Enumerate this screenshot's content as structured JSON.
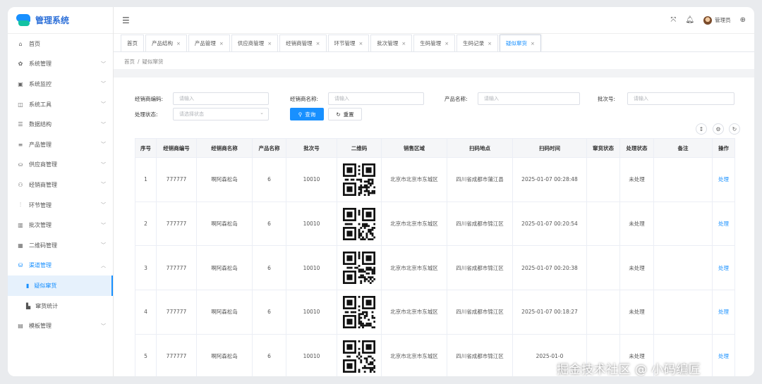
{
  "app": {
    "title": "管理系统"
  },
  "sidebar": {
    "items": [
      {
        "label": "首页",
        "icon": "home-icon",
        "glyph": "⌂",
        "chevron": false
      },
      {
        "label": "系统管理",
        "icon": "gear-icon",
        "glyph": "✿",
        "chevron": true
      },
      {
        "label": "系统监控",
        "icon": "monitor-icon",
        "glyph": "▣",
        "chevron": true
      },
      {
        "label": "系统工具",
        "icon": "toolbox-icon",
        "glyph": "◫",
        "chevron": true
      },
      {
        "label": "数据结构",
        "icon": "structure-icon",
        "glyph": "☰",
        "chevron": true
      },
      {
        "label": "产品管理",
        "icon": "list-icon",
        "glyph": "≡",
        "chevron": true
      },
      {
        "label": "供应商管理",
        "icon": "supplier-icon",
        "glyph": "⛀",
        "chevron": true
      },
      {
        "label": "经销商管理",
        "icon": "dealer-icon",
        "glyph": "⚇",
        "chevron": true
      },
      {
        "label": "环节管理",
        "icon": "step-icon",
        "glyph": "⫶",
        "chevron": true
      },
      {
        "label": "批次管理",
        "icon": "batch-icon",
        "glyph": "▥",
        "chevron": true
      },
      {
        "label": "二维码管理",
        "icon": "qrcode-icon",
        "glyph": "▦",
        "chevron": true
      },
      {
        "label": "渠道管理",
        "icon": "channel-icon",
        "glyph": "⛁",
        "chevron": true,
        "open": true
      },
      {
        "label": "疑似窜货",
        "icon": "suspect-icon",
        "glyph": "▮",
        "sub": true,
        "active": true
      },
      {
        "label": "窜货统计",
        "icon": "stats-icon",
        "glyph": "▙",
        "sub": true
      },
      {
        "label": "模板管理",
        "icon": "template-icon",
        "glyph": "▤",
        "chevron": true
      }
    ]
  },
  "header": {
    "user": "管理员"
  },
  "tabs": [
    {
      "label": "首页",
      "closable": false
    },
    {
      "label": "产品结构",
      "closable": true
    },
    {
      "label": "产品管理",
      "closable": true
    },
    {
      "label": "供应商管理",
      "closable": true
    },
    {
      "label": "经销商管理",
      "closable": true
    },
    {
      "label": "环节管理",
      "closable": true
    },
    {
      "label": "批次管理",
      "closable": true
    },
    {
      "label": "生码管理",
      "closable": true
    },
    {
      "label": "生码记录",
      "closable": true
    },
    {
      "label": "疑似窜货",
      "closable": true,
      "active": true
    }
  ],
  "breadcrumb": {
    "home": "首页",
    "current": "疑似窜货"
  },
  "search": {
    "dealer_code_label": "经销商编码:",
    "dealer_code_placeholder": "请输入",
    "dealer_name_label": "经销商名称:",
    "dealer_name_placeholder": "请输入",
    "product_label": "产品名称:",
    "product_placeholder": "请输入",
    "batch_label": "批次号:",
    "batch_placeholder": "请输入",
    "status_label": "处理状态:",
    "status_placeholder": "请选择状态",
    "query_label": "查询",
    "reset_label": "重置"
  },
  "table": {
    "columns": [
      "序号",
      "经销商编号",
      "经销商名称",
      "产品名称",
      "批次号",
      "二维码",
      "销售区域",
      "扫码地点",
      "扫码时间",
      "窜货状态",
      "处理状态",
      "备注",
      "操作"
    ],
    "rows": [
      {
        "no": "1",
        "dealer_code": "777777",
        "dealer_name": "啊阿森松岛",
        "product": "6",
        "batch": "10010",
        "region": "北京市北京市东城区",
        "scan_place": "四川省成都市蒲江县",
        "scan_time": "2025-01-07 00:28:48",
        "flee_status": "",
        "status": "未处理",
        "remark": "",
        "action": "处理"
      },
      {
        "no": "2",
        "dealer_code": "777777",
        "dealer_name": "啊阿森松岛",
        "product": "6",
        "batch": "10010",
        "region": "北京市北京市东城区",
        "scan_place": "四川省成都市锦江区",
        "scan_time": "2025-01-07 00:20:54",
        "flee_status": "",
        "status": "未处理",
        "remark": "",
        "action": "处理"
      },
      {
        "no": "3",
        "dealer_code": "777777",
        "dealer_name": "啊阿森松岛",
        "product": "6",
        "batch": "10010",
        "region": "北京市北京市东城区",
        "scan_place": "四川省成都市锦江区",
        "scan_time": "2025-01-07 00:20:38",
        "flee_status": "",
        "status": "未处理",
        "remark": "",
        "action": "处理"
      },
      {
        "no": "4",
        "dealer_code": "777777",
        "dealer_name": "啊阿森松岛",
        "product": "6",
        "batch": "10010",
        "region": "北京市北京市东城区",
        "scan_place": "四川省成都市锦江区",
        "scan_time": "2025-01-07 00:18:27",
        "flee_status": "",
        "status": "未处理",
        "remark": "",
        "action": "处理"
      },
      {
        "no": "5",
        "dealer_code": "777777",
        "dealer_name": "啊阿森松岛",
        "product": "6",
        "batch": "10010",
        "region": "北京市北京市东城区",
        "scan_place": "四川省成都市锦江区",
        "scan_time": "2025-01-0",
        "flee_status": "",
        "status": "未处理",
        "remark": "",
        "action": "处理"
      }
    ]
  },
  "watermark": "掘金技术社区 @ 小码编匠"
}
